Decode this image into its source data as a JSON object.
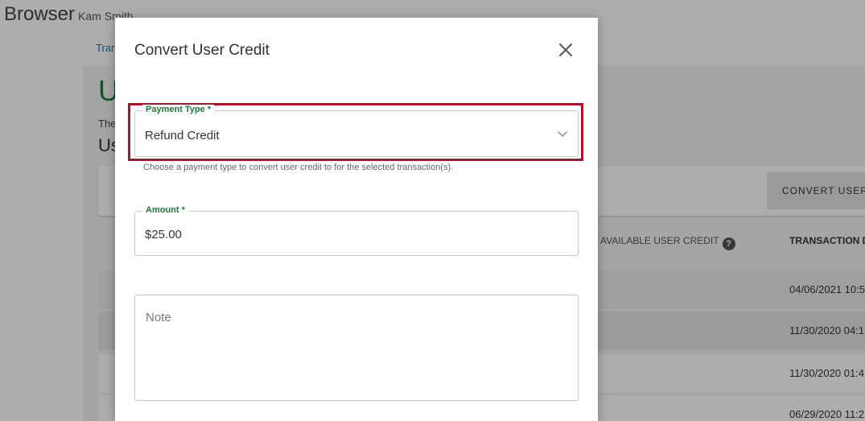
{
  "app": {
    "title": "Browser",
    "user": "Kam Smith"
  },
  "background": {
    "breadcrumb": "Tran",
    "page_heading": "U",
    "page_description": "The",
    "section_heading": "Us",
    "convert_button_label": "CONVERT USER",
    "columns": {
      "available_credit": "AVAILABLE USER CREDIT",
      "transaction_date": "TRANSACTION D"
    },
    "rows": [
      {
        "date": "04/06/2021 10:5"
      },
      {
        "date": "11/30/2020 04:1"
      },
      {
        "date": "11/30/2020 01:4"
      },
      {
        "date": "06/29/2020 11:2"
      }
    ]
  },
  "modal": {
    "title": "Convert User Credit",
    "payment_type": {
      "label": "Payment Type *",
      "value": "Refund Credit",
      "helper": "Choose a payment type to convert user credit to for the selected transaction(s)."
    },
    "amount": {
      "label": "Amount *",
      "value": "$25.00"
    },
    "note": {
      "placeholder": "Note"
    }
  },
  "colors": {
    "accent_green": "#1f7a3a",
    "highlight_red": "#b0122d"
  }
}
